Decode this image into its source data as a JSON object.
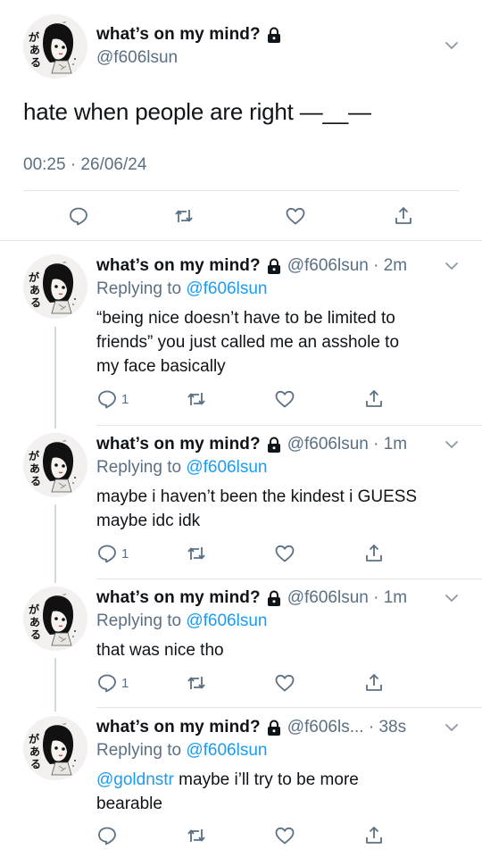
{
  "main_tweet": {
    "display_name": "what’s on my mind?",
    "handle": "@f606lsun",
    "text": "hate when people are right —__—",
    "timestamp": "00:25 · 26/06/24",
    "icons": [
      "lock-icon",
      "chevron-down-icon",
      "reply-icon",
      "retweet-icon",
      "like-icon",
      "share-icon"
    ]
  },
  "replies": [
    {
      "display_name": "what’s on my mind?",
      "handle_time": "@f606lsun · 2m",
      "replying_prefix": "Replying to ",
      "replying_to": "@f606lsun",
      "lines": [
        "“being nice doesn’t have to be limited to",
        "friends” you just called me an asshole to",
        "my face basically"
      ],
      "reply_count": "1"
    },
    {
      "display_name": "what’s on my mind?",
      "handle_time": "@f606lsun · 1m",
      "replying_prefix": "Replying to ",
      "replying_to": "@f606lsun",
      "lines": [
        "maybe i haven’t been the kindest i GUESS",
        "maybe idc idk"
      ],
      "reply_count": "1"
    },
    {
      "display_name": "what’s on my mind?",
      "handle_time": "@f606lsun · 1m",
      "replying_prefix": "Replying to ",
      "replying_to": "@f606lsun",
      "lines": [
        "that was nice tho"
      ],
      "reply_count": "1"
    },
    {
      "display_name": "what’s on my mind?",
      "handle_time": "@f606ls... · 38s",
      "replying_prefix": "Replying to ",
      "replying_to": "@f606lsun",
      "mention": "@goldnstr",
      "lines": [
        " maybe i’ll try to be more",
        "bearable"
      ],
      "reply_count": ""
    }
  ],
  "colors": {
    "text": "#0f1419",
    "secondary": "#5b7083",
    "link": "#1d9bf0",
    "divider": "#e2e6ea"
  }
}
